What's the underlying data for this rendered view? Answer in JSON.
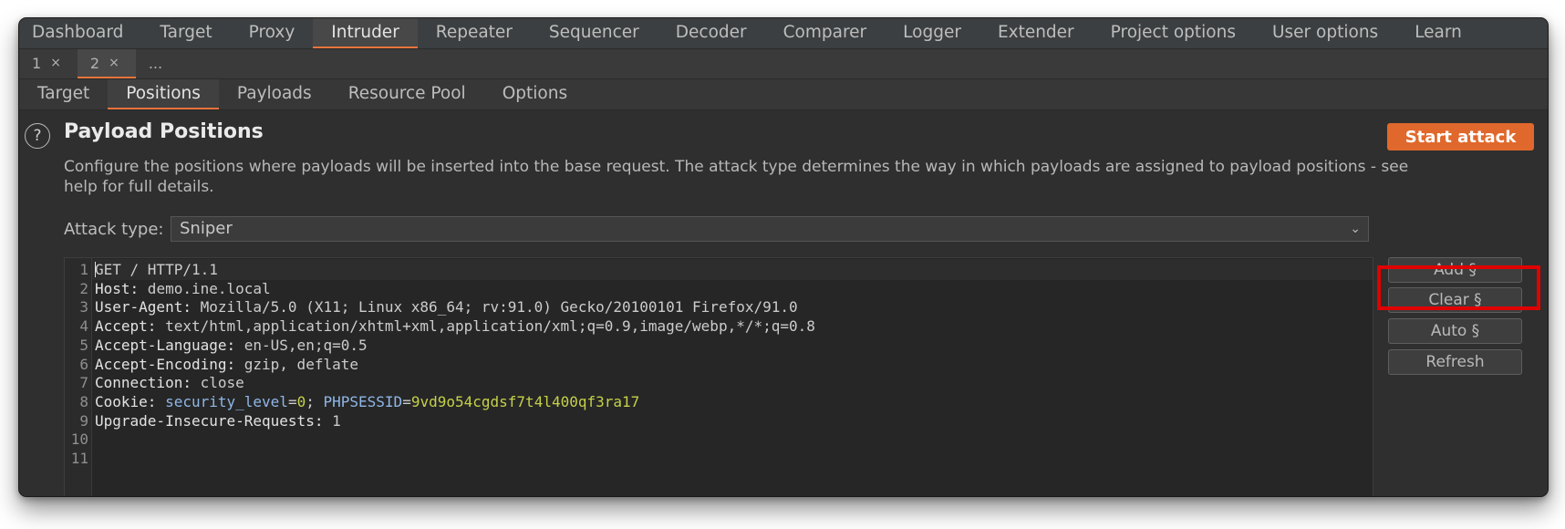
{
  "main_tabs": [
    "Dashboard",
    "Target",
    "Proxy",
    "Intruder",
    "Repeater",
    "Sequencer",
    "Decoder",
    "Comparer",
    "Logger",
    "Extender",
    "Project options",
    "User options",
    "Learn"
  ],
  "active_main_tab": "Intruder",
  "instance_tabs": [
    {
      "label": "1",
      "close": "×"
    },
    {
      "label": "2",
      "close": "×"
    },
    {
      "label": "...",
      "close": ""
    }
  ],
  "active_instance_tab": "2",
  "sub_tabs": [
    "Target",
    "Positions",
    "Payloads",
    "Resource Pool",
    "Options"
  ],
  "active_sub_tab": "Positions",
  "help_icon": "?",
  "section": {
    "title": "Payload Positions",
    "description": "Configure the positions where payloads will be inserted into the base request. The attack type determines the way in which payloads are assigned to payload positions - see help for full details."
  },
  "start_attack_label": "Start attack",
  "attack_type": {
    "label": "Attack type:",
    "value": "Sniper"
  },
  "request_lines": [
    {
      "no": "1",
      "parts": [
        {
          "t": "GET / HTTP/1.1",
          "c": "v"
        }
      ]
    },
    {
      "no": "2",
      "parts": [
        {
          "t": "Host:",
          "c": "k"
        },
        {
          "t": " demo.ine.local",
          "c": "v"
        }
      ]
    },
    {
      "no": "3",
      "parts": [
        {
          "t": "User-Agent:",
          "c": "k"
        },
        {
          "t": " Mozilla/5.0 (X11; Linux x86_64; rv:91.0) Gecko/20100101 Firefox/91.0",
          "c": "v"
        }
      ]
    },
    {
      "no": "4",
      "parts": [
        {
          "t": "Accept:",
          "c": "k"
        },
        {
          "t": " text/html,application/xhtml+xml,application/xml;q=0.9,image/webp,*/*;q=0.8",
          "c": "v"
        }
      ]
    },
    {
      "no": "5",
      "parts": [
        {
          "t": "Accept-Language:",
          "c": "k"
        },
        {
          "t": " en-US,en;q=0.5",
          "c": "v"
        }
      ]
    },
    {
      "no": "6",
      "parts": [
        {
          "t": "Accept-Encoding:",
          "c": "k"
        },
        {
          "t": " gzip, deflate",
          "c": "v"
        }
      ]
    },
    {
      "no": "7",
      "parts": [
        {
          "t": "Connection:",
          "c": "k"
        },
        {
          "t": " close",
          "c": "v"
        }
      ]
    },
    {
      "no": "8",
      "parts": [
        {
          "t": "Cookie:",
          "c": "k"
        },
        {
          "t": " ",
          "c": "v"
        },
        {
          "t": "security_level",
          "c": "p-name"
        },
        {
          "t": "=",
          "c": "v"
        },
        {
          "t": "0",
          "c": "p-val"
        },
        {
          "t": "; ",
          "c": "v"
        },
        {
          "t": "PHPSESSID",
          "c": "p-name"
        },
        {
          "t": "=",
          "c": "v"
        },
        {
          "t": "9vd9o54cgdsf7t4l400qf3ra17",
          "c": "p-val"
        }
      ]
    },
    {
      "no": "9",
      "parts": [
        {
          "t": "Upgrade-Insecure-Requests:",
          "c": "k"
        },
        {
          "t": " 1",
          "c": "v"
        }
      ]
    },
    {
      "no": "10",
      "parts": []
    },
    {
      "no": "11",
      "parts": []
    }
  ],
  "side_buttons": [
    "Add §",
    "Clear §",
    "Auto §",
    "Refresh"
  ],
  "highlighted_button": "Clear §",
  "colors": {
    "accent": "#e8743b",
    "start_button": "#e0682c",
    "highlight": "#e00000",
    "param_name": "#8fb7e8",
    "param_value": "#c6d149"
  }
}
